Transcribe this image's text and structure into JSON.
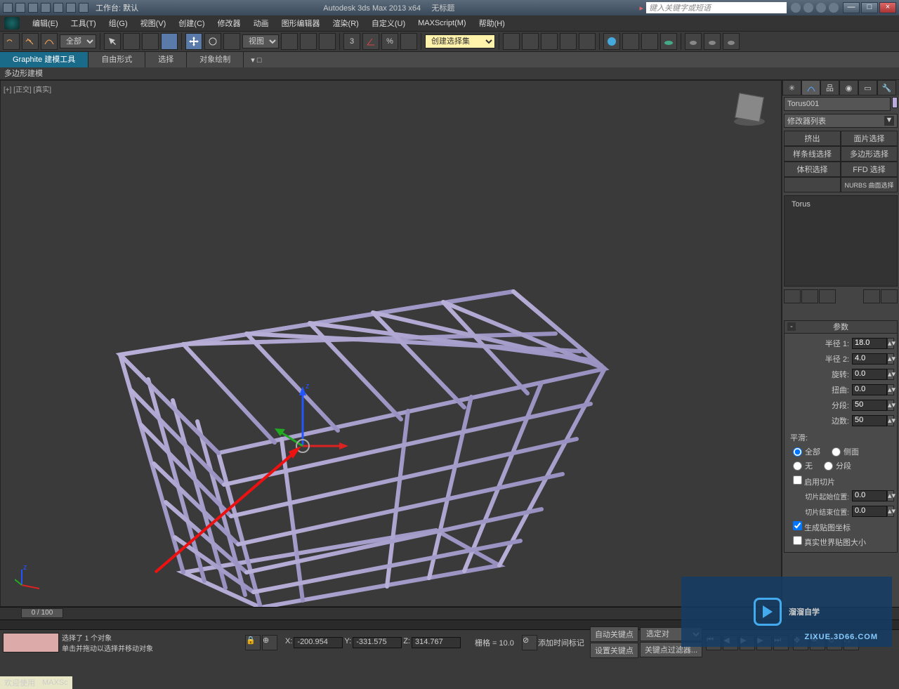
{
  "titlebar": {
    "workspace_label": "工作台: 默认",
    "app_title": "Autodesk 3ds Max  2013 x64",
    "doc_title": "无标题",
    "search_placeholder": "键入关键字或短语"
  },
  "menubar": {
    "items": [
      "编辑(E)",
      "工具(T)",
      "组(G)",
      "视图(V)",
      "创建(C)",
      "修改器",
      "动画",
      "图形编辑器",
      "渲染(R)",
      "自定义(U)",
      "MAXScript(M)",
      "帮助(H)"
    ]
  },
  "toolbar": {
    "sel_filter": "全部",
    "ref_coord": "视图",
    "named_set": "创建选择集"
  },
  "ribbon": {
    "title_tab": "Graphite 建模工具",
    "tabs": [
      "自由形式",
      "选择",
      "对象绘制"
    ],
    "sub": "多边形建模"
  },
  "viewport": {
    "label": "[+] [正交] [真实]"
  },
  "panel": {
    "object_name": "Torus001",
    "mod_list_label": "修改器列表",
    "uw": [
      [
        "挤出",
        "面片选择"
      ],
      [
        "样条线选择",
        "多边形选择"
      ],
      [
        "体积选择",
        "FFD 选择"
      ]
    ],
    "uw_last": "NURBS 曲面选择",
    "stack_item": "Torus",
    "rollout_title": "参数",
    "params": {
      "radius1_label": "半径 1:",
      "radius1": "18.0",
      "radius2_label": "半径 2:",
      "radius2": "4.0",
      "rotation_label": "旋转:",
      "rotation": "0.0",
      "twist_label": "扭曲:",
      "twist": "0.0",
      "segs_label": "分段:",
      "segs": "50",
      "sides_label": "边数:",
      "sides": "50"
    },
    "smooth_label": "平滑:",
    "smooth": {
      "all": "全部",
      "sides": "侧面",
      "none": "无",
      "segs": "分段"
    },
    "slice_enable": "启用切片",
    "slice_from_label": "切片起始位置:",
    "slice_from": "0.0",
    "slice_to_label": "切片结束位置:",
    "slice_to": "0.0",
    "gen_uv": "生成贴图坐标",
    "real_world": "真实世界贴图大小"
  },
  "timeline": {
    "slider": "0 / 100"
  },
  "status": {
    "line1": "选择了 1 个对象",
    "line2": "单击并拖动以选择并移动对象",
    "x": "-200.954",
    "y": "-331.575",
    "z": "314.767",
    "grid": "栅格 = 10.0",
    "autokey": "自动关键点",
    "setkey": "设置关键点",
    "keyfilter": "关键点过滤器...",
    "selset": "选定对",
    "addtag": "添加时间标记"
  },
  "tip": {
    "welcome": "欢迎使用",
    "maxsc": "MAXSc"
  },
  "watermark": {
    "main": "溜溜自学",
    "sub": "ZIXUE.3D66.COM"
  }
}
